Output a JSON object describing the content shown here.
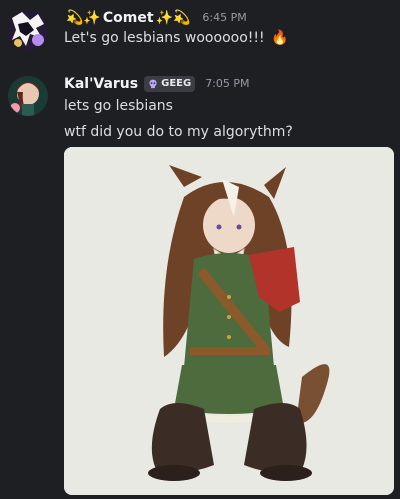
{
  "messages": [
    {
      "username": "Comet",
      "username_prefix_emoji": "💫✨",
      "username_suffix_emoji": "✨💫",
      "timestamp": "6:45 PM",
      "lines": [
        "Let's go lesbians woooooo!!!"
      ],
      "trailing_emoji": "🔥"
    },
    {
      "username": "Kal'Varus",
      "tag": "GEEG",
      "timestamp": "7:05 PM",
      "lines": [
        "lets go lesbians",
        "wtf did you do to my algorythm?"
      ],
      "attachment_description": "image"
    }
  ],
  "colors": {
    "background": "#1e1f22",
    "username": "#f2f3f5",
    "text": "#dbdee1",
    "timestamp": "#949ba4",
    "badge_bg": "#3b3d44",
    "attachment_bg": "#e9e9e4"
  }
}
